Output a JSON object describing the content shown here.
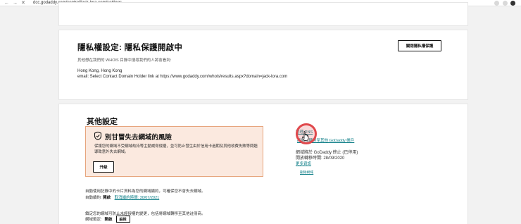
{
  "browser": {
    "url": "dcc.godaddy.com/control/jack-lora.com/settings",
    "back_icon": "arrow-left-icon",
    "forward_icon": "arrow-right-icon",
    "reload_icon": "close-icon"
  },
  "privacy": {
    "title": "隱私權設定: 隱私保護開啟中",
    "subtitle": "其他想在我們的 WHOIS 目錄中搜尋我們的人將會看到:",
    "address": "Hong Kong, Hong Kong",
    "email_line": "email: Select Contact Domain Holder link at https://www.godaddy.com/whois/results.aspx?domain=jack-lora.com",
    "button_label": "關閉隱私權保護"
  },
  "other_settings": {
    "title": "其他設定",
    "risk_title": "別甘冒失去網域的風險",
    "risk_desc": "保護您的網域不受網域劫持等主動威脅侵擾，並可防止發生由於信用卡過期及其他收費失敗等問題導致意外失去網域。",
    "upgrade_label": "升級",
    "auto_renew_desc": "自動使用記錄中的卡片資料為您的網域續約，可確保您不會失去網域。",
    "auto_renew_label": "自動續約:",
    "auto_renew_status": "開啟",
    "auto_renew_link": "取消續約時間: 30/07/2021",
    "lock_desc": "鎖定您的網域可防止未經授權的變更，包括將網域轉移至其他註冊商。",
    "lock_label": "網域鎖定:",
    "lock_status": "開啟",
    "edit_label": "編輯",
    "right": {
      "manage_link": "管理 DNS",
      "transfer_link": "將網域轉移至其他 GoDaddy 帳戶",
      "expire_text": "網域將於 GoDaddy 終止 (已停用)",
      "transfer_date_text": "開放轉移時間: 28/09/2020",
      "more_link": "更多資訊",
      "remove_link": "刪除網域"
    }
  },
  "colors": {
    "accent_teal": "#0a7c85",
    "risk_bg": "#fbe9df",
    "risk_border": "#e7a57d",
    "cursor_ring": "#e0484c"
  }
}
